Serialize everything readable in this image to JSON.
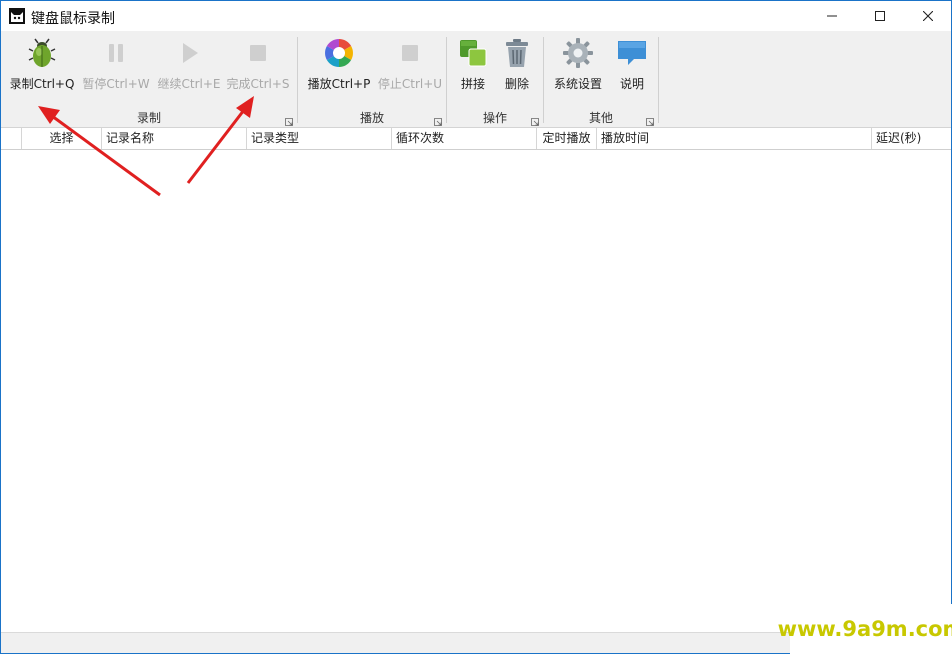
{
  "window": {
    "title": "键盘鼠标录制",
    "controls": {
      "minimize": "minimize-icon",
      "maximize": "maximize-icon",
      "close": "close-icon"
    }
  },
  "ribbon": {
    "groups": [
      {
        "label": "录制",
        "tools": [
          {
            "label": "录制Ctrl+Q",
            "icon": "bug-icon",
            "enabled": true
          },
          {
            "label": "暂停Ctrl+W",
            "icon": "pause-icon",
            "enabled": false
          },
          {
            "label": "继续Ctrl+E",
            "icon": "play-icon",
            "enabled": false
          },
          {
            "label": "完成Ctrl+S",
            "icon": "stop-icon",
            "enabled": false
          }
        ]
      },
      {
        "label": "播放",
        "tools": [
          {
            "label": "播放Ctrl+P",
            "icon": "color-wheel-icon",
            "enabled": true
          },
          {
            "label": "停止Ctrl+U",
            "icon": "stop-icon",
            "enabled": false
          }
        ]
      },
      {
        "label": "操作",
        "tools": [
          {
            "label": "拼接",
            "icon": "merge-squares-icon",
            "enabled": true
          },
          {
            "label": "删除",
            "icon": "trash-icon",
            "enabled": true
          }
        ]
      },
      {
        "label": "其他",
        "tools": [
          {
            "label": "系统设置",
            "icon": "gear-icon",
            "enabled": true
          },
          {
            "label": "说明",
            "icon": "speech-bubble-icon",
            "enabled": true
          }
        ]
      }
    ]
  },
  "table": {
    "columns": [
      "选择",
      "记录名称",
      "记录类型",
      "循环次数",
      "定时播放",
      "播放时间",
      "延迟(秒)"
    ],
    "rows": []
  },
  "watermark": "www.9a9m.com",
  "colors": {
    "accent_border": "#1a73c8",
    "ribbon_bg": "#f0f0f0",
    "disabled_text": "#a8a8a8",
    "annotation_arrow": "#e02020",
    "watermark": "#c8c800"
  }
}
